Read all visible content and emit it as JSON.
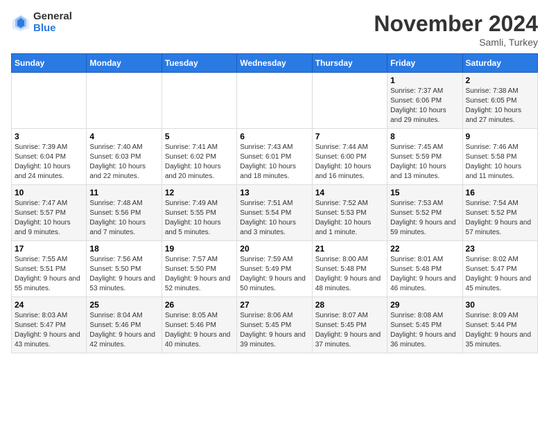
{
  "logo": {
    "general": "General",
    "blue": "Blue"
  },
  "header": {
    "month": "November 2024",
    "location": "Samli, Turkey"
  },
  "weekdays": [
    "Sunday",
    "Monday",
    "Tuesday",
    "Wednesday",
    "Thursday",
    "Friday",
    "Saturday"
  ],
  "weeks": [
    [
      {
        "day": "",
        "info": ""
      },
      {
        "day": "",
        "info": ""
      },
      {
        "day": "",
        "info": ""
      },
      {
        "day": "",
        "info": ""
      },
      {
        "day": "",
        "info": ""
      },
      {
        "day": "1",
        "info": "Sunrise: 7:37 AM\nSunset: 6:06 PM\nDaylight: 10 hours and 29 minutes."
      },
      {
        "day": "2",
        "info": "Sunrise: 7:38 AM\nSunset: 6:05 PM\nDaylight: 10 hours and 27 minutes."
      }
    ],
    [
      {
        "day": "3",
        "info": "Sunrise: 7:39 AM\nSunset: 6:04 PM\nDaylight: 10 hours and 24 minutes."
      },
      {
        "day": "4",
        "info": "Sunrise: 7:40 AM\nSunset: 6:03 PM\nDaylight: 10 hours and 22 minutes."
      },
      {
        "day": "5",
        "info": "Sunrise: 7:41 AM\nSunset: 6:02 PM\nDaylight: 10 hours and 20 minutes."
      },
      {
        "day": "6",
        "info": "Sunrise: 7:43 AM\nSunset: 6:01 PM\nDaylight: 10 hours and 18 minutes."
      },
      {
        "day": "7",
        "info": "Sunrise: 7:44 AM\nSunset: 6:00 PM\nDaylight: 10 hours and 16 minutes."
      },
      {
        "day": "8",
        "info": "Sunrise: 7:45 AM\nSunset: 5:59 PM\nDaylight: 10 hours and 13 minutes."
      },
      {
        "day": "9",
        "info": "Sunrise: 7:46 AM\nSunset: 5:58 PM\nDaylight: 10 hours and 11 minutes."
      }
    ],
    [
      {
        "day": "10",
        "info": "Sunrise: 7:47 AM\nSunset: 5:57 PM\nDaylight: 10 hours and 9 minutes."
      },
      {
        "day": "11",
        "info": "Sunrise: 7:48 AM\nSunset: 5:56 PM\nDaylight: 10 hours and 7 minutes."
      },
      {
        "day": "12",
        "info": "Sunrise: 7:49 AM\nSunset: 5:55 PM\nDaylight: 10 hours and 5 minutes."
      },
      {
        "day": "13",
        "info": "Sunrise: 7:51 AM\nSunset: 5:54 PM\nDaylight: 10 hours and 3 minutes."
      },
      {
        "day": "14",
        "info": "Sunrise: 7:52 AM\nSunset: 5:53 PM\nDaylight: 10 hours and 1 minute."
      },
      {
        "day": "15",
        "info": "Sunrise: 7:53 AM\nSunset: 5:52 PM\nDaylight: 9 hours and 59 minutes."
      },
      {
        "day": "16",
        "info": "Sunrise: 7:54 AM\nSunset: 5:52 PM\nDaylight: 9 hours and 57 minutes."
      }
    ],
    [
      {
        "day": "17",
        "info": "Sunrise: 7:55 AM\nSunset: 5:51 PM\nDaylight: 9 hours and 55 minutes."
      },
      {
        "day": "18",
        "info": "Sunrise: 7:56 AM\nSunset: 5:50 PM\nDaylight: 9 hours and 53 minutes."
      },
      {
        "day": "19",
        "info": "Sunrise: 7:57 AM\nSunset: 5:50 PM\nDaylight: 9 hours and 52 minutes."
      },
      {
        "day": "20",
        "info": "Sunrise: 7:59 AM\nSunset: 5:49 PM\nDaylight: 9 hours and 50 minutes."
      },
      {
        "day": "21",
        "info": "Sunrise: 8:00 AM\nSunset: 5:48 PM\nDaylight: 9 hours and 48 minutes."
      },
      {
        "day": "22",
        "info": "Sunrise: 8:01 AM\nSunset: 5:48 PM\nDaylight: 9 hours and 46 minutes."
      },
      {
        "day": "23",
        "info": "Sunrise: 8:02 AM\nSunset: 5:47 PM\nDaylight: 9 hours and 45 minutes."
      }
    ],
    [
      {
        "day": "24",
        "info": "Sunrise: 8:03 AM\nSunset: 5:47 PM\nDaylight: 9 hours and 43 minutes."
      },
      {
        "day": "25",
        "info": "Sunrise: 8:04 AM\nSunset: 5:46 PM\nDaylight: 9 hours and 42 minutes."
      },
      {
        "day": "26",
        "info": "Sunrise: 8:05 AM\nSunset: 5:46 PM\nDaylight: 9 hours and 40 minutes."
      },
      {
        "day": "27",
        "info": "Sunrise: 8:06 AM\nSunset: 5:45 PM\nDaylight: 9 hours and 39 minutes."
      },
      {
        "day": "28",
        "info": "Sunrise: 8:07 AM\nSunset: 5:45 PM\nDaylight: 9 hours and 37 minutes."
      },
      {
        "day": "29",
        "info": "Sunrise: 8:08 AM\nSunset: 5:45 PM\nDaylight: 9 hours and 36 minutes."
      },
      {
        "day": "30",
        "info": "Sunrise: 8:09 AM\nSunset: 5:44 PM\nDaylight: 9 hours and 35 minutes."
      }
    ]
  ]
}
